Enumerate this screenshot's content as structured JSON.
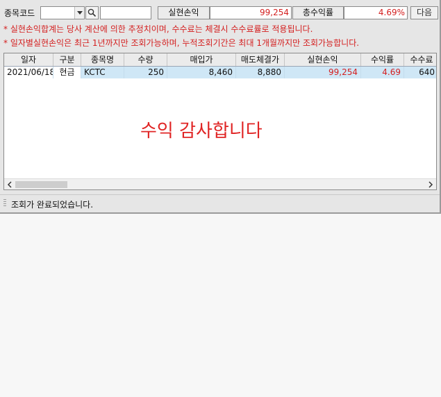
{
  "toolbar": {
    "code_label": "종목코드",
    "code_value": "",
    "name_value": "",
    "realized_pnl_label": "실현손익",
    "realized_pnl_value": "99,254",
    "total_return_label": "총수익률",
    "total_return_value": "4.69%",
    "next_label": "다음"
  },
  "notes": [
    "* 실현손익합계는 당사 계산에 의한 추정치이며, 수수료는 체결시 수수료률로 적용됩니다.",
    "* 일자별실현손익은 최근 1년까지만 조회가능하며, 누적조회기간은 최대 1개월까지만 조회가능합니다."
  ],
  "table": {
    "columns": [
      "일자",
      "구분",
      "종목명",
      "수량",
      "매입가",
      "매도체결가",
      "실현손익",
      "수익률",
      "수수료"
    ],
    "rows": [
      [
        "2021/06/18",
        "현금",
        "KCTC",
        "250",
        "8,460",
        "8,880",
        "99,254",
        "4.69",
        "640"
      ]
    ]
  },
  "overlay_text": "수익 감사합니다",
  "status": "조회가 완료되었습니다.",
  "colors": {
    "accent_red": "#d42020",
    "selected_row": "#cfe7f6",
    "header_bg": "#ebebeb"
  },
  "icons": [
    "chevron-down-icon",
    "search-icon",
    "scroll-left-icon",
    "scroll-right-icon",
    "status-grip-icon"
  ]
}
